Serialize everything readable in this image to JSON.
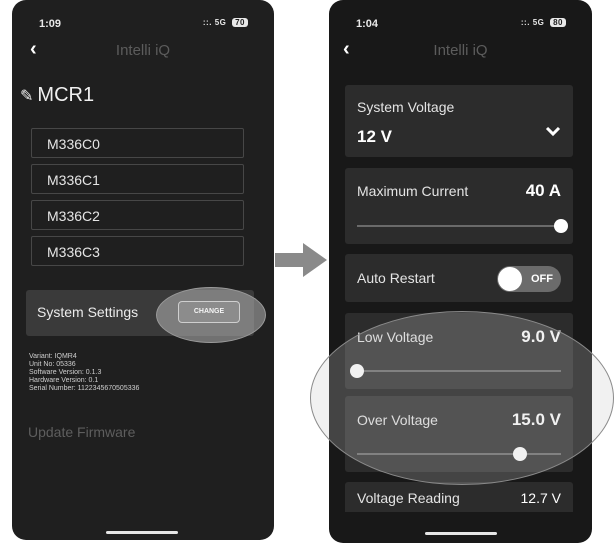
{
  "left": {
    "time": "1:09",
    "signal": "5G",
    "battery": "70",
    "app_title": "Intelli iQ",
    "device_name": "MCR1",
    "devices": [
      "M336C0",
      "M336C1",
      "M336C2",
      "M336C3"
    ],
    "settings_label": "System Settings",
    "change_label": "CHANGE",
    "info": {
      "variant": "Variant: IQMR4",
      "unit": "Unit No: 05336",
      "software": "Software Version: 0.1.3",
      "hardware": "Hardware Version: 0.1",
      "serial": "Serial Number: 1122345670505336"
    },
    "update_label": "Update Firmware"
  },
  "right": {
    "time": "1:04",
    "signal": "5G",
    "battery": "80",
    "app_title": "Intelli iQ",
    "system_voltage": {
      "label": "System Voltage",
      "value": "12 V"
    },
    "max_current": {
      "label": "Maximum Current",
      "value": "40 A",
      "slider_fraction": 1.0
    },
    "auto_restart": {
      "label": "Auto Restart",
      "state": "OFF"
    },
    "low_voltage": {
      "label": "Low Voltage",
      "value": "9.0 V",
      "slider_fraction": 0.0
    },
    "over_voltage": {
      "label": "Over Voltage",
      "value": "15.0 V",
      "slider_fraction": 0.8
    },
    "voltage_reading": {
      "label": "Voltage Reading",
      "value": "12.7 V"
    }
  },
  "colors": {
    "background": "#1f1f1f",
    "card": "#2c2c2c",
    "accent": "#ffffff"
  },
  "icons": {
    "back": "chevron-left-icon",
    "edit": "pencil-icon",
    "dropdown": "chevron-down-icon",
    "arrow": "right-arrow-icon"
  }
}
